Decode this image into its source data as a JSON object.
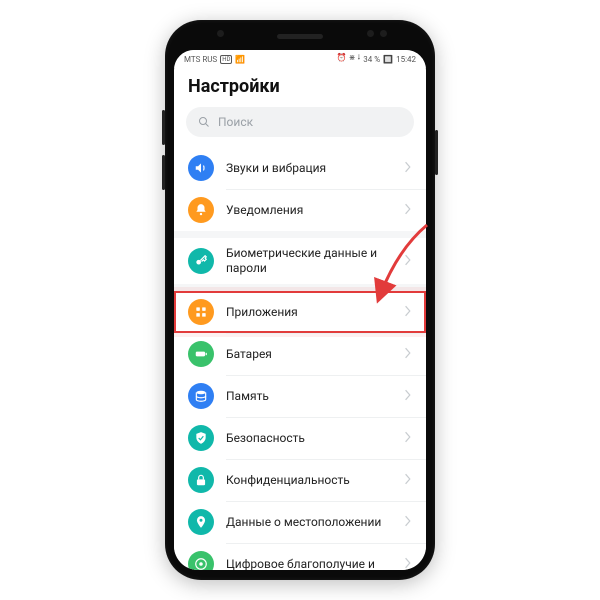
{
  "statusbar": {
    "carrier": "MTS RUS",
    "net_badge": "HD",
    "signal": "▮▮▮",
    "icons": "⏰ ⋇ ⭭",
    "battery_pct": "34 %",
    "time": "15:42"
  },
  "page_title": "Настройки",
  "search": {
    "placeholder": "Поиск"
  },
  "colors": {
    "blue": "#2f7ff3",
    "orange": "#ff9a1f",
    "teal": "#10b8aa",
    "green": "#39c26b",
    "highlight": "#e23b3b"
  },
  "items": [
    {
      "id": "sound",
      "label": "Звуки и вибрация",
      "color": "#2f7ff3",
      "icon": "volume"
    },
    {
      "id": "notifications",
      "label": "Уведомления",
      "color": "#ff9a1f",
      "icon": "bell"
    },
    {
      "id": "biometrics",
      "label": "Биометрические данные и пароли",
      "color": "#10b8aa",
      "icon": "key"
    },
    {
      "id": "apps",
      "label": "Приложения",
      "color": "#ff9a1f",
      "icon": "apps",
      "highlighted": true
    },
    {
      "id": "battery",
      "label": "Батарея",
      "color": "#39c26b",
      "icon": "battery"
    },
    {
      "id": "memory",
      "label": "Память",
      "color": "#2f7ff3",
      "icon": "storage"
    },
    {
      "id": "security",
      "label": "Безопасность",
      "color": "#10b8aa",
      "icon": "shield"
    },
    {
      "id": "privacy",
      "label": "Конфиденциальность",
      "color": "#10b8aa",
      "icon": "lock"
    },
    {
      "id": "location",
      "label": "Данные о местоположении",
      "color": "#10b8aa",
      "icon": "pin"
    },
    {
      "id": "wellbeing",
      "label": "Цифровое благополучие и",
      "color": "#39c26b",
      "icon": "wellbeing"
    }
  ],
  "section_gaps_after": [
    "notifications",
    "biometrics"
  ]
}
